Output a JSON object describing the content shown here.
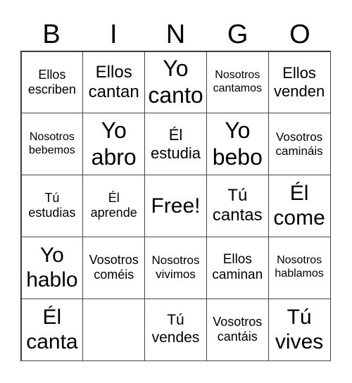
{
  "header": [
    "B",
    "I",
    "N",
    "G",
    "O"
  ],
  "cells": [
    [
      "Ellos escriben",
      "Ellos cantan",
      "Yo canto",
      "Nosotros cantamos",
      "Ellos venden"
    ],
    [
      "Nosotros bebemos",
      "Yo abro",
      "Él estudia",
      "Yo bebo",
      "Vosotros camináis"
    ],
    [
      "Tú estudias",
      "Él aprende",
      "Free!",
      "Tú cantas",
      "Él come"
    ],
    [
      "Yo hablo",
      "Vosotros coméis",
      "Nosotros vivimos",
      "Ellos caminan",
      "Nosotros hablamos"
    ],
    [
      "Él canta",
      "",
      "Tú vendes",
      "Vosotros cantáis",
      "Tú vives"
    ]
  ]
}
